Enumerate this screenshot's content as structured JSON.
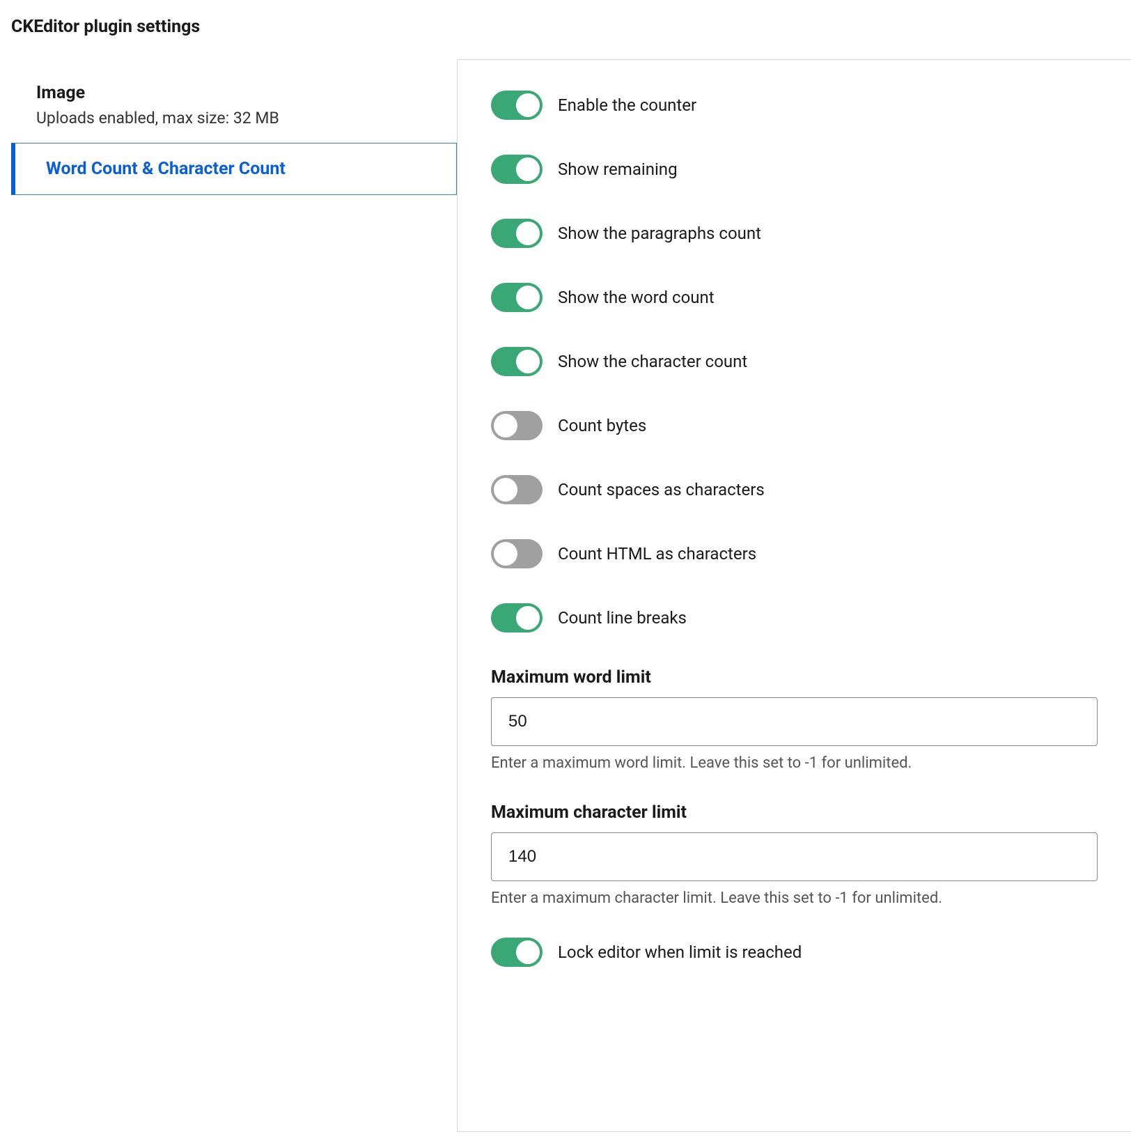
{
  "page_title": "CKEditor plugin settings",
  "sidebar": {
    "tabs": [
      {
        "title": "Image",
        "subtitle": "Uploads enabled, max size: 32 MB",
        "active": false
      },
      {
        "title": "Word Count & Character Count",
        "subtitle": "",
        "active": true
      }
    ]
  },
  "toggles": [
    {
      "label": "Enable the counter",
      "on": true,
      "name": "toggle-enable-counter"
    },
    {
      "label": "Show remaining",
      "on": true,
      "name": "toggle-show-remaining"
    },
    {
      "label": "Show the paragraphs count",
      "on": true,
      "name": "toggle-show-paragraphs"
    },
    {
      "label": "Show the word count",
      "on": true,
      "name": "toggle-show-word-count"
    },
    {
      "label": "Show the character count",
      "on": true,
      "name": "toggle-show-char-count"
    },
    {
      "label": "Count bytes",
      "on": false,
      "name": "toggle-count-bytes"
    },
    {
      "label": "Count spaces as characters",
      "on": false,
      "name": "toggle-count-spaces"
    },
    {
      "label": "Count HTML as characters",
      "on": false,
      "name": "toggle-count-html"
    },
    {
      "label": "Count line breaks",
      "on": true,
      "name": "toggle-count-line-breaks"
    }
  ],
  "fields": {
    "max_word": {
      "label": "Maximum word limit",
      "value": "50",
      "help": "Enter a maximum word limit. Leave this set to -1 for unlimited."
    },
    "max_char": {
      "label": "Maximum character limit",
      "value": "140",
      "help": "Enter a maximum character limit. Leave this set to -1 for unlimited."
    }
  },
  "toggles_after": [
    {
      "label": "Lock editor when limit is reached",
      "on": true,
      "name": "toggle-lock-editor"
    }
  ]
}
